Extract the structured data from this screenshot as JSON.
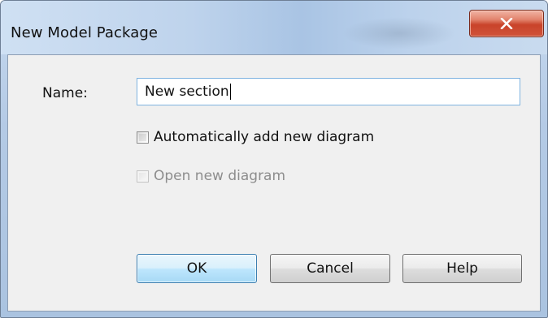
{
  "window": {
    "title": "New Model Package",
    "close_label": "X"
  },
  "form": {
    "name_label": "Name:",
    "name_value": "New section",
    "auto_add_label": "Automatically add new diagram",
    "auto_add_checked": false,
    "open_new_label": "Open new diagram",
    "open_new_checked": false,
    "open_new_enabled": false
  },
  "buttons": {
    "ok": "OK",
    "cancel": "Cancel",
    "help": "Help"
  }
}
